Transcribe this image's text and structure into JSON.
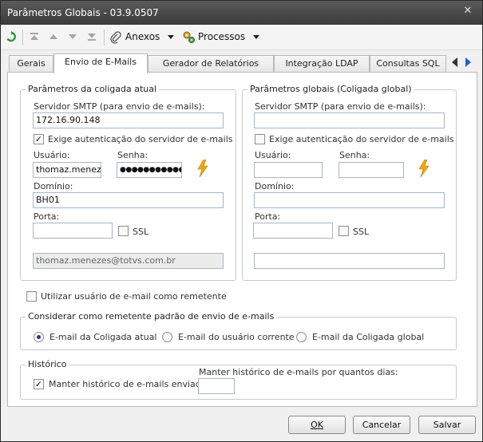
{
  "window": {
    "title": "Parâmetros Globais - 03.9.0507",
    "close_glyph": "✕"
  },
  "toolbar": {
    "anexos_label": "Anexos",
    "processos_label": "Processos"
  },
  "tabs": [
    {
      "label": "Gerais"
    },
    {
      "label": "Envio de E-Mails"
    },
    {
      "label": "Gerador de Relatórios"
    },
    {
      "label": "Integração LDAP"
    },
    {
      "label": "Consultas SQL"
    }
  ],
  "local": {
    "group_label": "Parâmetros da coligada atual",
    "smtp_label": "Servidor SMTP (para envio de e-mails):",
    "smtp_value": "172.16.90.148",
    "auth_label": "Exige autenticação do servidor de e-mails",
    "auth_checked": true,
    "user_label": "Usuário:",
    "user_value": "thomaz.menezes",
    "password_label": "Senha:",
    "password_value": "●●●●●●●●●●●",
    "domain_label": "Domínio:",
    "domain_value": "BH01",
    "port_label": "Porta:",
    "port_value": "",
    "ssl_label": "SSL",
    "email_value": "thomaz.menezes@totvs.com.br"
  },
  "global": {
    "group_label": "Parâmetros globais (Coligada global)",
    "smtp_label": "Servidor SMTP (para envio de e-mails):",
    "smtp_value": "",
    "auth_label": "Exige autenticação do servidor de e-mails",
    "auth_checked": false,
    "user_label": "Usuário:",
    "user_value": "",
    "password_label": "Senha:",
    "password_value": "",
    "domain_label": "Domínio:",
    "domain_value": "",
    "port_label": "Porta:",
    "port_value": "",
    "ssl_label": "SSL",
    "email_value": ""
  },
  "use_user_email_label": "Utilizar usuário de e-mail como remetente",
  "sender": {
    "group_label": "Considerar como remetente padrão de envio de e-mails",
    "options": [
      {
        "label": "E-mail da Coligada atual",
        "selected": true
      },
      {
        "label": "E-mail do usuário corrente",
        "selected": false
      },
      {
        "label": "E-mail da Coligada global",
        "selected": false
      }
    ]
  },
  "history": {
    "group_label": "Histórico",
    "keep_label": "Manter histórico de e-mails enviados",
    "keep_checked": true,
    "days_label": "Manter histórico de e-mails por quantos dias:",
    "days_value": ""
  },
  "footer": {
    "ok_label": "OK",
    "cancel_label": "Cancelar",
    "save_label": "Salvar"
  },
  "colors": {
    "accent_bolt": "#f0a800",
    "refresh_green": "#2a9a2a",
    "selected_radio": "#1f3b8a"
  }
}
